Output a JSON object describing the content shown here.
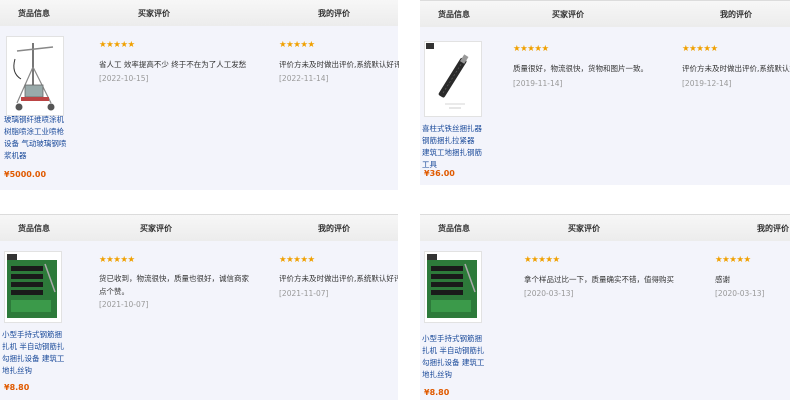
{
  "header": {
    "col_product": "货品信息",
    "col_buyer": "买家评价",
    "col_mine": "我的评价"
  },
  "star_text": "★★★★★",
  "reviews": [
    {
      "product_name": "玻璃钢纤维喷涂机树脂喷涂工业喷枪设备 气动玻璃钢喷浆机器",
      "price": "¥5000.00",
      "buyer_comment": "省人工 效率提高不少 终于不在为了人工发愁",
      "buyer_date": "[2022-10-15]",
      "my_comment": "评价方未及时做出评价,系统默认好评!",
      "my_date": "[2022-11-14]"
    },
    {
      "product_name": "喜柱式铁丝捆扎器钢筋捆扎拉紧器 建筑工地捆扎钢筋工具",
      "price": "¥36.00",
      "buyer_comment": "质量很好，物流很快，货物和图片一致。",
      "buyer_date": "[2019-11-14]",
      "my_comment": "评价方未及时做出评价,系统默认好评!",
      "my_date": "[2019-12-14]"
    },
    {
      "product_name": "小型手持式钢筋捆扎机 半自动钢筋扎勾捆扎设备 建筑工地扎丝钩",
      "price": "¥8.80",
      "buyer_comment": "货已收到，物流很快，质量也很好，诚信商家点个赞。",
      "buyer_date": "[2021-10-07]",
      "my_comment": "评价方未及时做出评价,系统默认好评!",
      "my_date": "[2021-11-07]"
    },
    {
      "product_name": "小型手持式钢筋捆扎机 半自动钢筋扎勾捆扎设备 建筑工地扎丝钩",
      "price": "¥8.80",
      "buyer_comment": "拿个样品过比一下，质量确实不错，值得购买",
      "buyer_date": "[2020-03-13]",
      "my_comment": "感谢",
      "my_date": "[2020-03-13]"
    }
  ]
}
